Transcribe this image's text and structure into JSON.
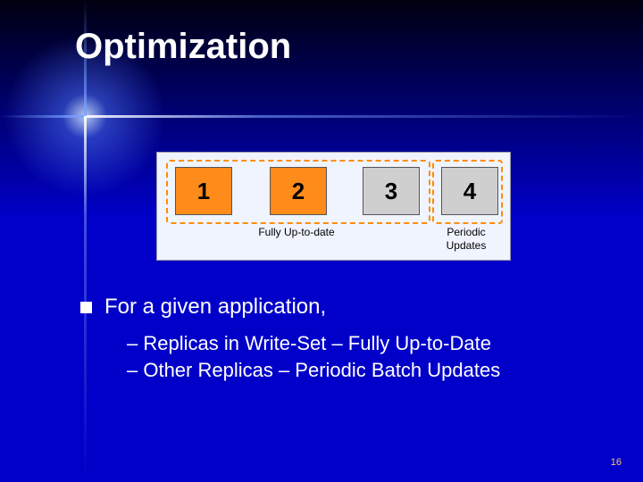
{
  "title": "Optimization",
  "diagram": {
    "boxes": [
      "1",
      "2",
      "3",
      "4"
    ],
    "cap_left": "Fully Up-to-date",
    "cap_right": "Periodic Updates"
  },
  "body": {
    "main": "For a given application,",
    "sub1": "– Replicas in Write-Set – Fully Up-to-Date",
    "sub2": "– Other Replicas – Periodic Batch Updates"
  },
  "page": "16"
}
